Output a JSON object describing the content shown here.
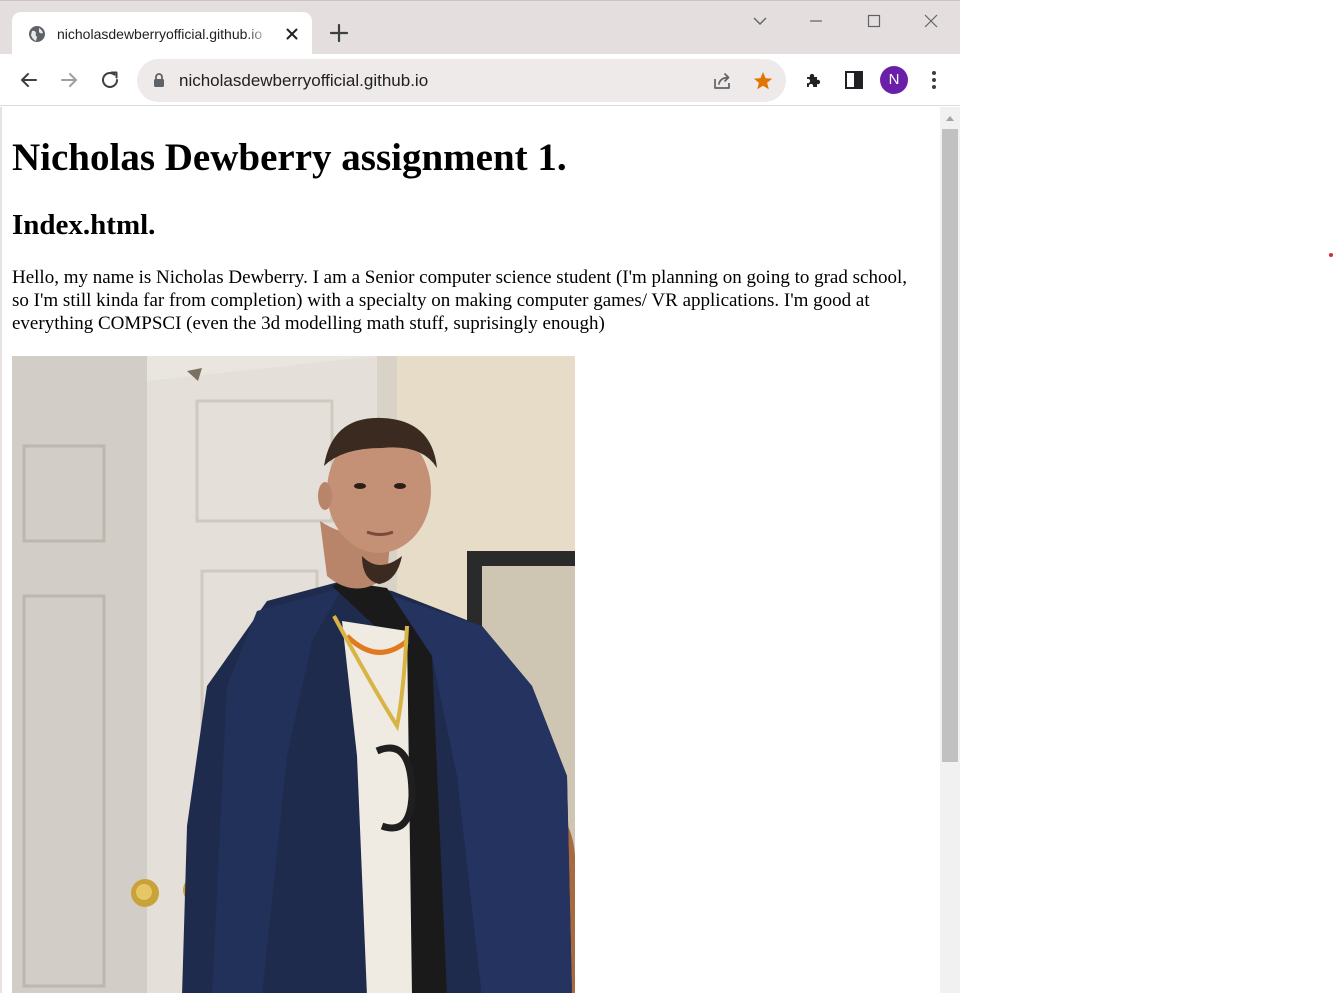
{
  "browser": {
    "tab": {
      "title": "nicholasdewberryofficial.github.io"
    },
    "address_bar": {
      "url": "nicholasdewberryofficial.github.io"
    },
    "profile_initial": "N",
    "colors": {
      "star": "#e37400",
      "profile": "#6a1fa9",
      "titlebar": "#e4dede"
    },
    "icons": [
      "globe-icon",
      "close-icon",
      "plus-icon",
      "chevron-down-icon",
      "minimize-icon",
      "maximize-icon",
      "window-close-icon",
      "back-arrow-icon",
      "forward-arrow-icon",
      "reload-icon",
      "lock-icon",
      "share-icon",
      "star-icon",
      "puzzle-icon",
      "side-panel-icon",
      "kebab-menu-icon"
    ]
  },
  "page": {
    "heading": "Nicholas Dewberry assignment 1.",
    "subheading": "Index.html.",
    "paragraph": "Hello, my name is Nicholas Dewberry. I am a Senior computer science student (I'm planning on going to grad school, so I'm still kinda far from completion) with a specialty on making computer games/ VR applications. I'm good at everything COMPSCI (even the 3d modelling math stuff, suprisingly enough)"
  }
}
